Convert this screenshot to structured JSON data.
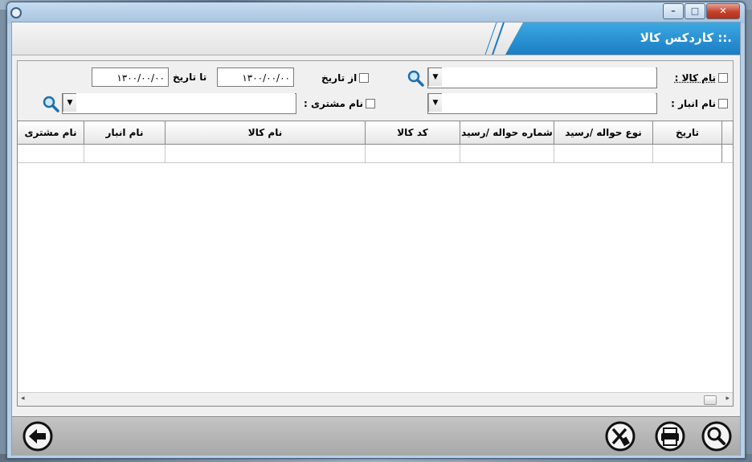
{
  "window": {
    "title": ""
  },
  "header": {
    "title": ".:: کاردکس کالا"
  },
  "filters": {
    "item_name_label": "نام کالا :",
    "warehouse_label": "نام انبار :",
    "from_date_label": "از تاریخ",
    "to_date_label": "تا تاریخ",
    "customer_label": "نام مشتری :",
    "from_date_value": "۱۳۰۰/۰۰/۰۰",
    "to_date_value": "۱۳۰۰/۰۰/۰۰",
    "item_name_value": "",
    "warehouse_value": "",
    "customer_value": ""
  },
  "grid": {
    "columns": [
      "تاریخ",
      "نوع حواله /رسید",
      "شماره حواله /رسید",
      "کد کالا",
      "نام کالا",
      "نام انبار",
      "نام مشتری"
    ]
  },
  "icons": {
    "search": "search-icon",
    "dropdown": "chevron-down-icon",
    "back": "back-arrow-icon",
    "clear": "clear-icon",
    "print": "print-icon"
  },
  "colors": {
    "header_blue": "#1f86cc",
    "toolbar": "#b4b4b4"
  }
}
